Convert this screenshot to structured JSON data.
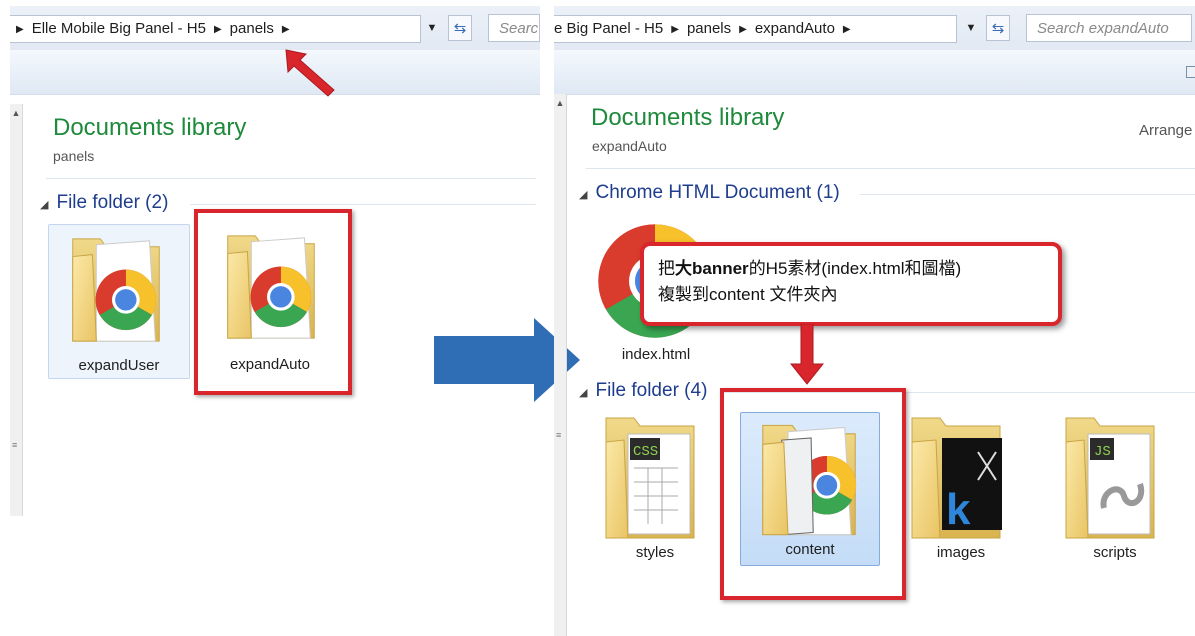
{
  "left": {
    "breadcrumb": [
      "Elle Mobile Big Panel - H5",
      "panels"
    ],
    "search_placeholder": "Searc",
    "library_title": "Documents library",
    "library_sub": "panels",
    "group_label": "File folder (2)",
    "items": [
      "expandUser",
      "expandAuto"
    ]
  },
  "right": {
    "breadcrumb": [
      "e Big Panel - H5",
      "panels",
      "expandAuto"
    ],
    "search_placeholder": "Search expandAuto",
    "library_title": "Documents library",
    "library_sub": "expandAuto",
    "arrange_label": "Arrange",
    "group1_label": "Chrome HTML Document (1)",
    "file_item": "index.html",
    "group2_label": "File folder (4)",
    "folders": [
      "styles",
      "content",
      "images",
      "scripts"
    ],
    "callout": {
      "pre": "把",
      "bold1": "大banner",
      "post1": "的H5素材(index.html和圖檔)",
      "line2": "複製到content 文件夾內"
    }
  },
  "colors": {
    "annotation_red": "#d9262c",
    "arrow_blue": "#2f6db5",
    "library_green": "#1e8a3b",
    "group_blue": "#1e3d8f"
  }
}
